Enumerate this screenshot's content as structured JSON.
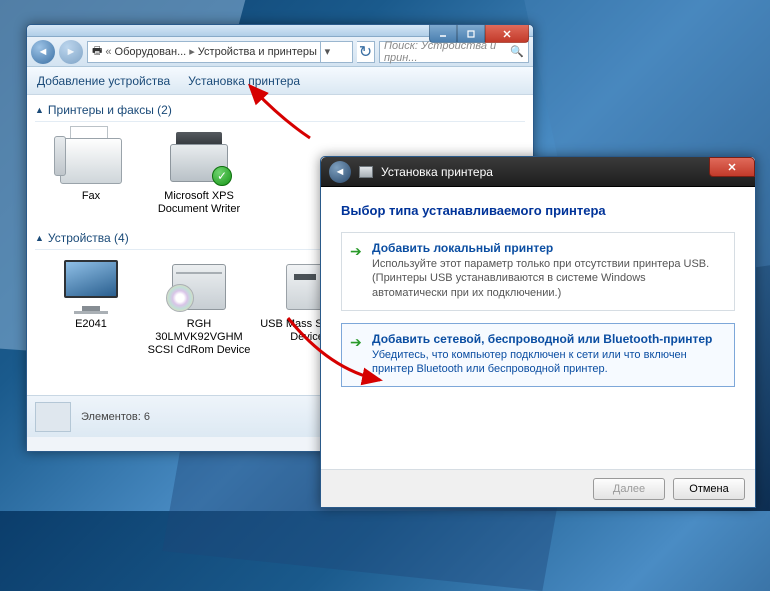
{
  "breadcrumb": {
    "parent": "Оборудован...",
    "current": "Устройства и принтеры"
  },
  "search": {
    "placeholder": "Поиск: Устройства и прин..."
  },
  "cmdbar": {
    "add_device": "Добавление устройства",
    "add_printer": "Установка принтера"
  },
  "groups": {
    "printers": {
      "title": "Принтеры и факсы (2)"
    },
    "devices": {
      "title": "Устройства (4)"
    }
  },
  "items": {
    "fax": "Fax",
    "xps": "Microsoft XPS Document Writer",
    "monitor": "E2041",
    "hdd": "RGH 30LMVK92VGHM SCSI CdRom Device",
    "usb": "USB Mass Storage Device"
  },
  "status": {
    "label": "Элементов: 6"
  },
  "wizard": {
    "title": "Установка принтера",
    "heading": "Выбор типа устанавливаемого принтера",
    "opt_local": {
      "title": "Добавить локальный принтер",
      "desc": "Используйте этот параметр только при отсутствии принтера USB. (Принтеры USB устанавливаются в системе Windows автоматически при их подключении.)"
    },
    "opt_net": {
      "title": "Добавить сетевой, беспроводной или Bluetooth-принтер",
      "desc": "Убедитесь, что компьютер подключен к сети или что включен принтер Bluetooth или беспроводной принтер."
    },
    "next": "Далее",
    "cancel": "Отмена"
  }
}
